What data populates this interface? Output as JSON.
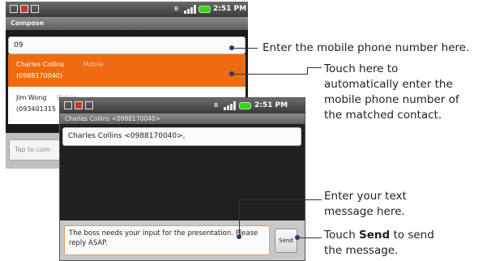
{
  "phone_compose": {
    "status_time": "2:51 PM",
    "title": "Compose",
    "to_value": "09",
    "suggestions": [
      {
        "name": "Charles Collins",
        "type": "Mobile",
        "number": "(0988170040)"
      },
      {
        "name": "Jim Wong",
        "type": "Mobile",
        "number": "(093401315"
      }
    ],
    "message_placeholder": "Tap to com"
  },
  "phone_conversation": {
    "status_time": "2:51 PM",
    "title": "Charles Collins <0988170040>",
    "to_value": "Charles Collins <0988170040>,",
    "message_text": "The boss needs your input for the presentation. Please reply ASAP.",
    "send_label": "Send"
  },
  "callouts": {
    "enter_number": "Enter the mobile phone number here.",
    "touch_here": [
      "Touch here to",
      "automatically enter the",
      "mobile phone number of",
      "the matched contact."
    ],
    "enter_text": [
      "Enter your text",
      "message here."
    ],
    "touch_send_prefix": "Touch ",
    "touch_send_bold": "Send",
    "touch_send_suffix": " to send",
    "touch_send_line2": "the message."
  },
  "colors": {
    "highlight": "#ef6b10",
    "battery": "#39d11a"
  }
}
